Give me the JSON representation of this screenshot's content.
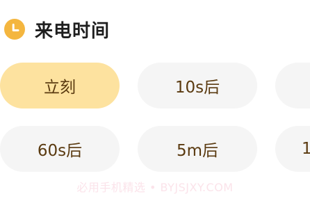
{
  "section": {
    "title": "来电时间",
    "icon": "clock-icon",
    "icon_color": "#f4b63f"
  },
  "options": [
    {
      "label": "立刻",
      "selected": true
    },
    {
      "label": "10s后",
      "selected": false
    },
    {
      "label": "",
      "selected": false
    },
    {
      "label": "60s后",
      "selected": false
    },
    {
      "label": "5m后",
      "selected": false
    },
    {
      "label": "1",
      "selected": false
    }
  ],
  "colors": {
    "selected_bg": "#fde29f",
    "chip_bg": "#f5f5f5",
    "chip_text": "#5a3a10"
  },
  "watermark": "必用手机精选 • BYJSJXY.COM"
}
